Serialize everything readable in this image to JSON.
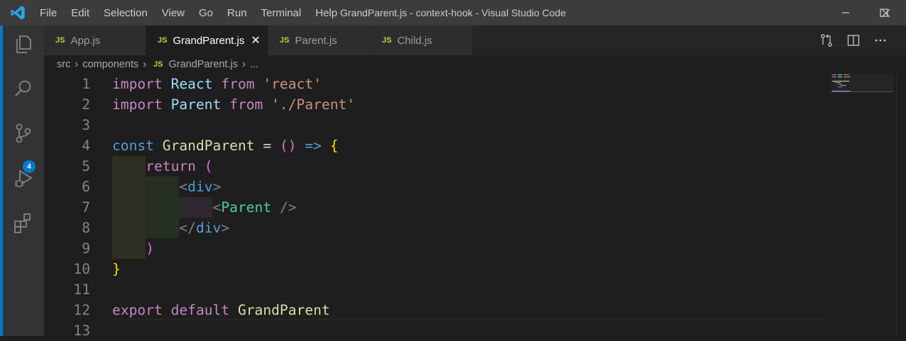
{
  "window": {
    "title": "GrandParent.js - context-hook - Visual Studio Code",
    "menu": [
      "File",
      "Edit",
      "Selection",
      "View",
      "Go",
      "Run",
      "Terminal",
      "Help"
    ]
  },
  "activity_bar": {
    "items": [
      "explorer-icon",
      "search-icon",
      "source-control-icon",
      "run-debug-icon",
      "extensions-icon"
    ],
    "source_control_badge": "4"
  },
  "tabs": [
    {
      "icon": "JS",
      "label": "App.js",
      "active": false
    },
    {
      "icon": "JS",
      "label": "GrandParent.js",
      "active": true
    },
    {
      "icon": "JS",
      "label": "Parent.js",
      "active": false
    },
    {
      "icon": "JS",
      "label": "Child.js",
      "active": false
    }
  ],
  "breadcrumb": {
    "parts": [
      "src",
      "components"
    ],
    "file_icon": "JS",
    "file": "GrandParent.js",
    "more": "..."
  },
  "editor": {
    "line_numbers": [
      "1",
      "2",
      "3",
      "4",
      "5",
      "6",
      "7",
      "8",
      "9",
      "10",
      "11",
      "12",
      "13"
    ],
    "lines": [
      {
        "tokens": [
          [
            "import",
            "kw-purple"
          ],
          [
            " ",
            ""
          ],
          [
            "React",
            "var"
          ],
          [
            " ",
            ""
          ],
          [
            "from",
            "kw-purple"
          ],
          [
            " ",
            ""
          ],
          [
            "'react'",
            "str"
          ]
        ]
      },
      {
        "tokens": [
          [
            "import",
            "kw-purple"
          ],
          [
            " ",
            ""
          ],
          [
            "Parent",
            "var"
          ],
          [
            " ",
            ""
          ],
          [
            "from",
            "kw-purple"
          ],
          [
            " ",
            ""
          ],
          [
            "'./Parent'",
            "str"
          ]
        ]
      },
      {
        "tokens": []
      },
      {
        "tokens": [
          [
            "const",
            "kw-blue"
          ],
          [
            " ",
            ""
          ],
          [
            "GrandParent",
            "fn"
          ],
          [
            " = ",
            "op"
          ],
          [
            "()",
            "brk2"
          ],
          [
            " ",
            ""
          ],
          [
            "=>",
            "kw-blue"
          ],
          [
            " ",
            ""
          ],
          [
            "{",
            "brk1"
          ]
        ]
      },
      {
        "tokens": [
          [
            "    ",
            ""
          ],
          [
            "return",
            "kw-purple"
          ],
          [
            " ",
            ""
          ],
          [
            "(",
            "brk2"
          ]
        ]
      },
      {
        "tokens": [
          [
            "        ",
            ""
          ],
          [
            "<",
            "punc"
          ],
          [
            "div",
            "tag"
          ],
          [
            ">",
            "punc"
          ]
        ]
      },
      {
        "tokens": [
          [
            "            ",
            ""
          ],
          [
            "<",
            "punc"
          ],
          [
            "Parent",
            "comp"
          ],
          [
            " ",
            ""
          ],
          [
            "/>",
            "punc"
          ]
        ]
      },
      {
        "tokens": [
          [
            "        ",
            ""
          ],
          [
            "</",
            "punc"
          ],
          [
            "div",
            "tag"
          ],
          [
            ">",
            "punc"
          ]
        ]
      },
      {
        "tokens": [
          [
            "    ",
            ""
          ],
          [
            ")",
            "brk2"
          ]
        ]
      },
      {
        "tokens": [
          [
            "}",
            "brk1"
          ]
        ]
      },
      {
        "tokens": []
      },
      {
        "tokens": [
          [
            "export",
            "kw-purple"
          ],
          [
            " ",
            ""
          ],
          [
            "default",
            "kw-purple"
          ],
          [
            " ",
            ""
          ],
          [
            "GrandParent",
            "fn"
          ]
        ]
      },
      {
        "tokens": []
      }
    ]
  },
  "colors": {
    "accent": "#007acc",
    "js_icon": "#cbcb41"
  }
}
